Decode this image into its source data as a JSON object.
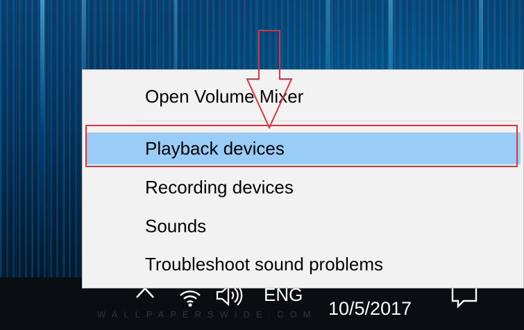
{
  "menu": {
    "items": [
      {
        "label": "Open Volume Mixer"
      },
      {
        "label": "Playback devices",
        "highlighted": true
      },
      {
        "label": "Recording devices"
      },
      {
        "label": "Sounds"
      },
      {
        "label": "Troubleshoot sound problems"
      }
    ]
  },
  "taskbar": {
    "language": "ENG",
    "date": "10/5/2017",
    "tray_icons": [
      "chevron-up-icon",
      "network-icon",
      "volume-icon",
      "notification-icon"
    ]
  },
  "watermark": "WALLPAPERSWIDE.COM",
  "colors": {
    "menu_background": "#f2f2f2",
    "selection_highlight": "#99ccf7",
    "annotation_red": "#e0323c",
    "taskbar": "#0a0d12"
  }
}
